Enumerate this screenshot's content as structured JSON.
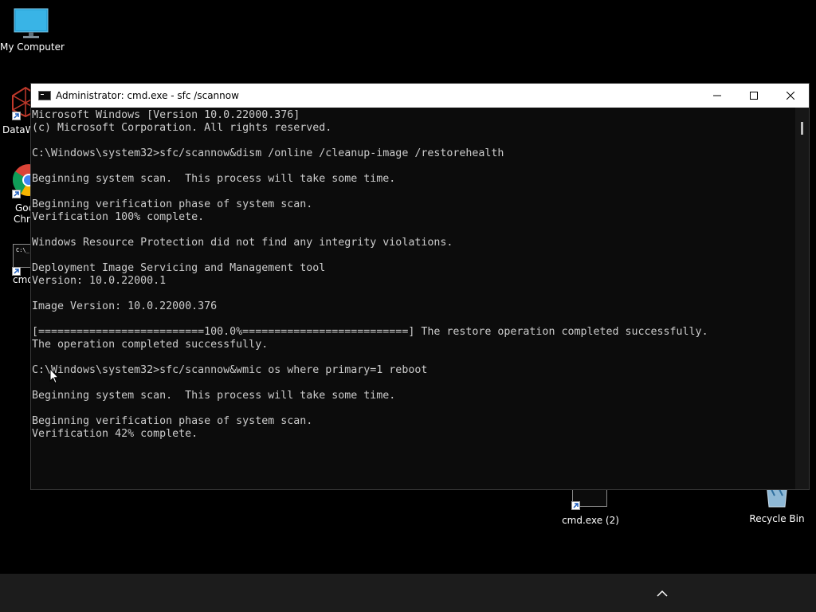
{
  "desktop": {
    "icons": {
      "my_computer": "My Computer",
      "datawrapper": "DataW",
      "chrome_line1": "Goo",
      "chrome_line2": "Chro",
      "cmd_left": "cmd",
      "cmd2": "cmd.exe (2)",
      "recycle_bin": "Recycle Bin"
    }
  },
  "window": {
    "title": "Administrator: cmd.exe - sfc /scannow",
    "icon": "console-icon",
    "buttons": {
      "minimize": "minimize-icon",
      "maximize": "maximize-icon",
      "close": "close-icon"
    }
  },
  "console": {
    "lines": [
      "Microsoft Windows [Version 10.0.22000.376]",
      "(c) Microsoft Corporation. All rights reserved.",
      "",
      "C:\\Windows\\system32>sfc/scannow&dism /online /cleanup-image /restorehealth",
      "",
      "Beginning system scan.  This process will take some time.",
      "",
      "Beginning verification phase of system scan.",
      "Verification 100% complete.",
      "",
      "Windows Resource Protection did not find any integrity violations.",
      "",
      "Deployment Image Servicing and Management tool",
      "Version: 10.0.22000.1",
      "",
      "Image Version: 10.0.22000.376",
      "",
      "[==========================100.0%==========================] The restore operation completed successfully.",
      "The operation completed successfully.",
      "",
      "C:\\Windows\\system32>sfc/scannow&wmic os where primary=1 reboot",
      "",
      "Beginning system scan.  This process will take some time.",
      "",
      "Beginning verification phase of system scan.",
      "Verification 42% complete."
    ]
  },
  "taskbar": {
    "tray_icon": "chevron-up-icon"
  },
  "colors": {
    "desktop_bg": "#000000",
    "console_bg": "#0c0c0c",
    "console_text": "#cccccc",
    "titlebar_bg": "#ffffff",
    "taskbar_bg": "#1c1c1c"
  }
}
